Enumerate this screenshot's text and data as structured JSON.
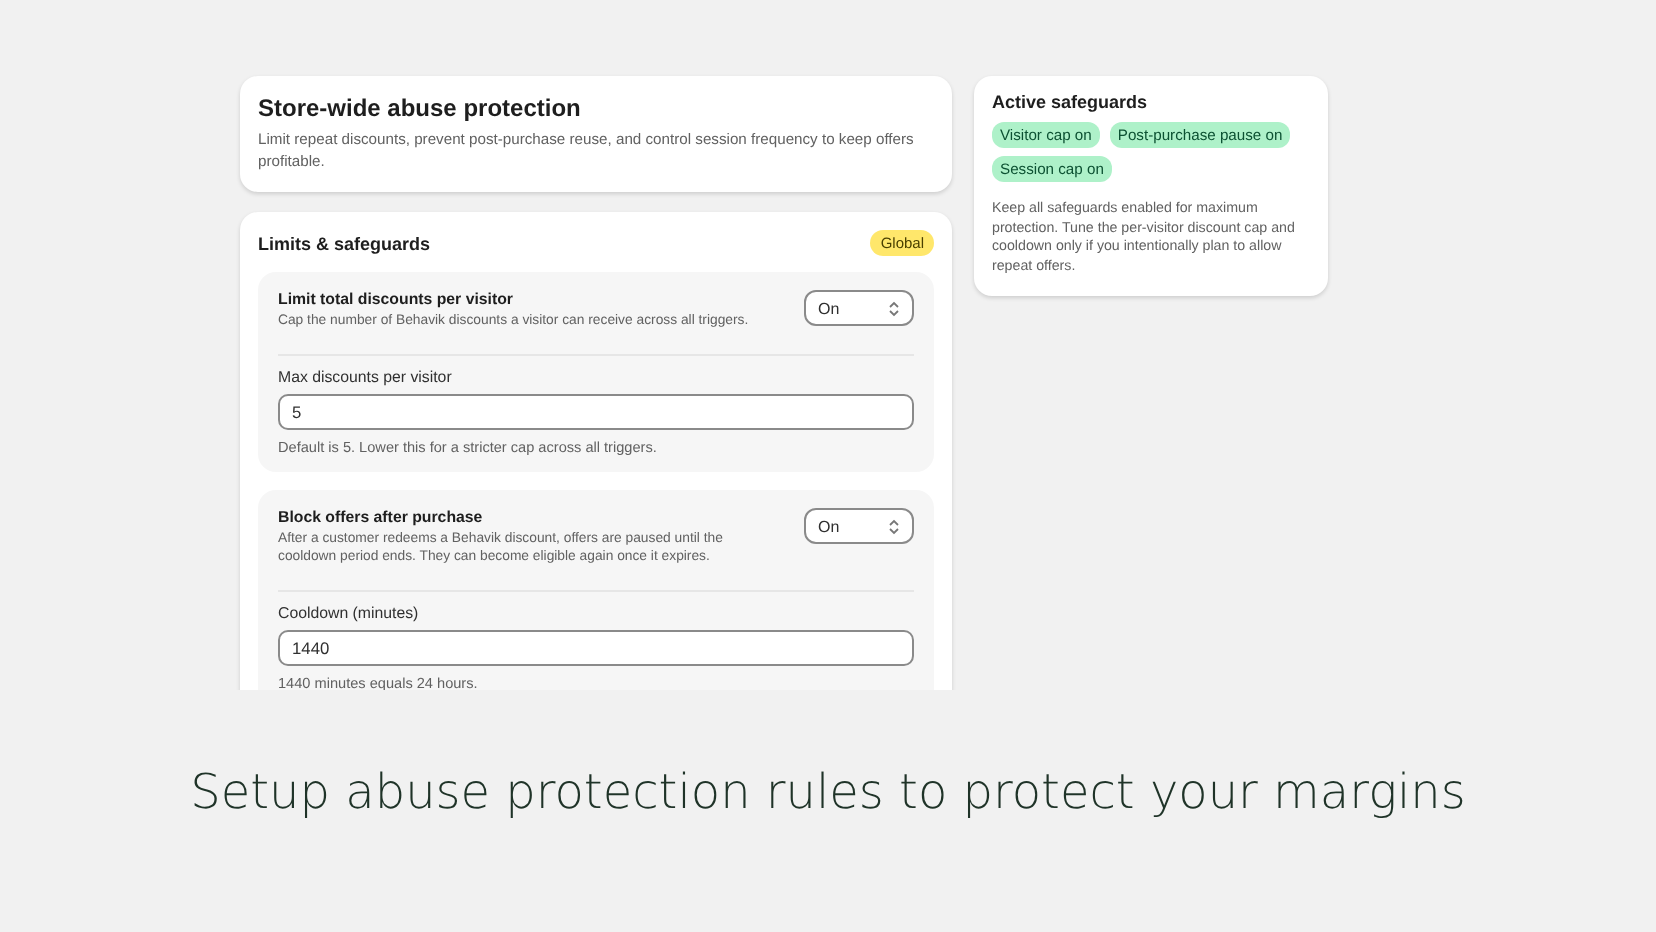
{
  "header": {
    "title": "Store-wide abuse protection",
    "description": "Limit repeat discounts, prevent post-purchase reuse, and control session frequency to keep offers profitable."
  },
  "limits": {
    "title": "Limits & safeguards",
    "badge": "Global",
    "sections": [
      {
        "title": "Limit total discounts per visitor",
        "description": "Cap the number of Behavik discounts a visitor can receive across all triggers.",
        "select": "On",
        "field_label": "Max discounts per visitor",
        "field_value": "5",
        "help": "Default is 5. Lower this for a stricter cap across all triggers."
      },
      {
        "title": "Block offers after purchase",
        "description": "After a customer redeems a Behavik discount, offers are paused until the cooldown period ends. They can become eligible again once it expires.",
        "select": "On",
        "field_label": "Cooldown (minutes)",
        "field_value": "1440",
        "help": "1440 minutes equals 24 hours."
      }
    ]
  },
  "safeguards": {
    "title": "Active safeguards",
    "tags": [
      "Visitor cap on",
      "Post-purchase pause on",
      "Session cap on"
    ],
    "note": "Keep all safeguards enabled for maximum protection. Tune the per-visitor discount cap and cooldown only if you intentionally plan to allow repeat offers."
  },
  "caption": "Setup abuse protection rules to protect your margins"
}
